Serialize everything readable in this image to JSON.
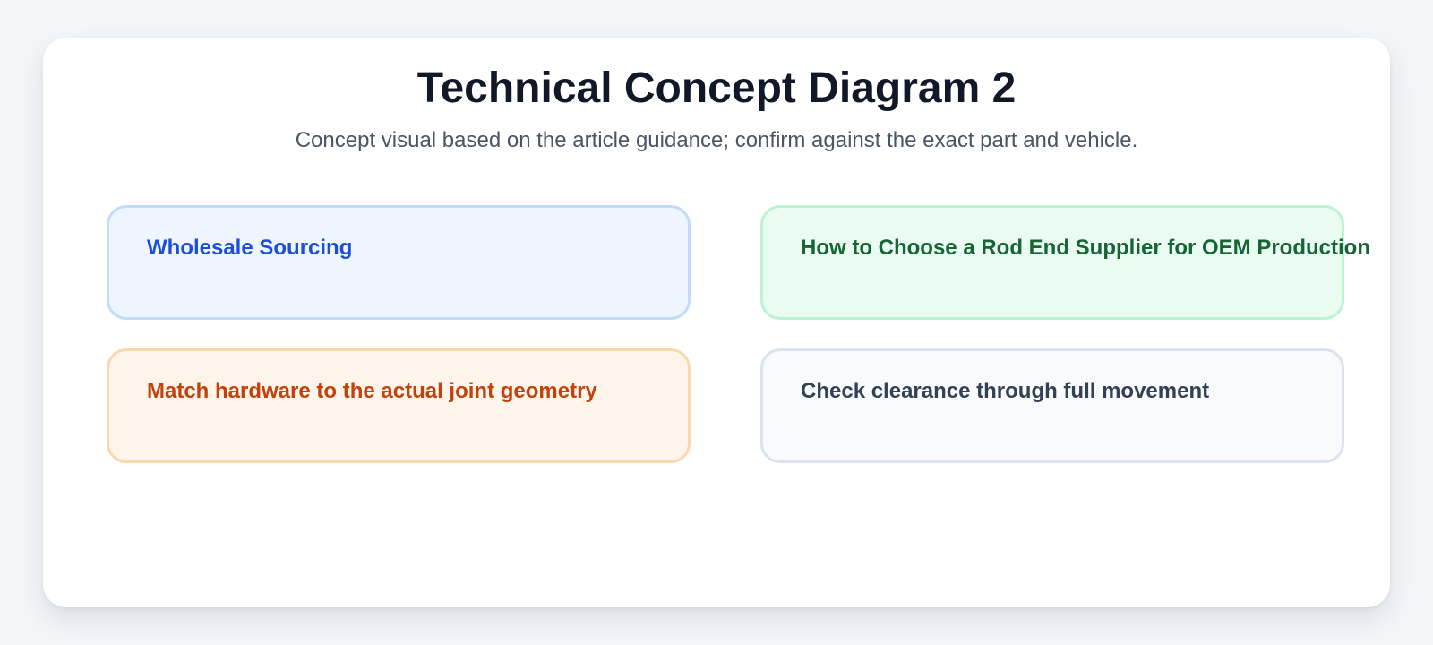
{
  "diagram": {
    "title": "Technical Concept Diagram 2",
    "subtitle": "Concept visual based on the article guidance; confirm against the exact part and vehicle.",
    "boxes": [
      {
        "label": "Wholesale Sourcing",
        "text_color": "#1d4ed8",
        "fill_color": "#eef5fd",
        "border_color": "#c2dcf8"
      },
      {
        "label": "How to Choose a Rod End Supplier for OEM Production",
        "text_color": "#166534",
        "fill_color": "#eafcf2",
        "border_color": "#bcf3d2"
      },
      {
        "label": "Match hardware to the actual joint geometry",
        "text_color": "#c2410c",
        "fill_color": "#fdf5ea",
        "border_color": "#fad8ad"
      },
      {
        "label": "Check clearance through full movement",
        "text_color": "#334155",
        "fill_color": "#f8fafc",
        "border_color": "#dbe3ee"
      }
    ]
  }
}
